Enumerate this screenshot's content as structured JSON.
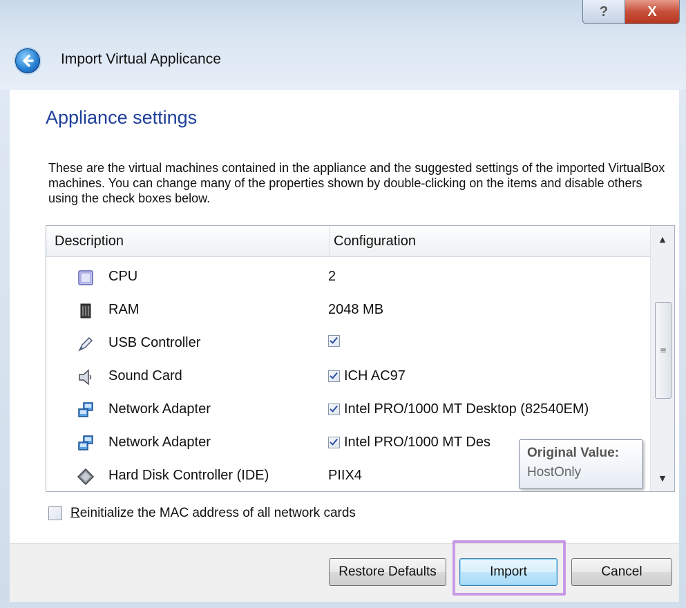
{
  "window": {
    "title": "Import Virtual Applicance",
    "help_glyph": "?",
    "close_glyph": "X",
    "back_icon": "back-arrow-icon"
  },
  "page": {
    "title": "Appliance settings",
    "intro": "These are the virtual machines contained in the appliance and the suggested settings of the imported VirtualBox machines. You can change many of the properties shown by double-clicking on the items and disable others using the check boxes below."
  },
  "table": {
    "headers": {
      "description": "Description",
      "configuration": "Configuration"
    },
    "rows": [
      {
        "icon": "cpu-icon",
        "description": "CPU",
        "value": "2",
        "checkbox": null
      },
      {
        "icon": "ram-icon",
        "description": "RAM",
        "value": "2048 MB",
        "checkbox": null
      },
      {
        "icon": "usb-icon",
        "description": "USB Controller",
        "value": "",
        "checkbox": true
      },
      {
        "icon": "speaker-icon",
        "description": "Sound Card",
        "value": "ICH AC97",
        "checkbox": true
      },
      {
        "icon": "network-icon",
        "description": "Network Adapter",
        "value": "Intel PRO/1000 MT Desktop (82540EM)",
        "checkbox": true
      },
      {
        "icon": "network-icon",
        "description": "Network Adapter",
        "value": "Intel PRO/1000 MT Des",
        "checkbox": true
      },
      {
        "icon": "disk-controller-icon",
        "description": "Hard Disk Controller (IDE)",
        "value": "PIIX4",
        "checkbox": null
      }
    ],
    "scrollbar": {
      "grip_glyph": "≡",
      "up_glyph": "▲",
      "down_glyph": "▼"
    }
  },
  "tooltip": {
    "title": "Original Value:",
    "value": "HostOnly"
  },
  "reinit_mac": {
    "label_accel": "R",
    "label_rest": "einitialize the MAC address of all network cards",
    "checked": false
  },
  "buttons": {
    "restore": "Restore Defaults",
    "import": "Import",
    "cancel": "Cancel"
  },
  "colors": {
    "title_blue": "#1e3f9a",
    "highlight": "#c79ae6"
  }
}
